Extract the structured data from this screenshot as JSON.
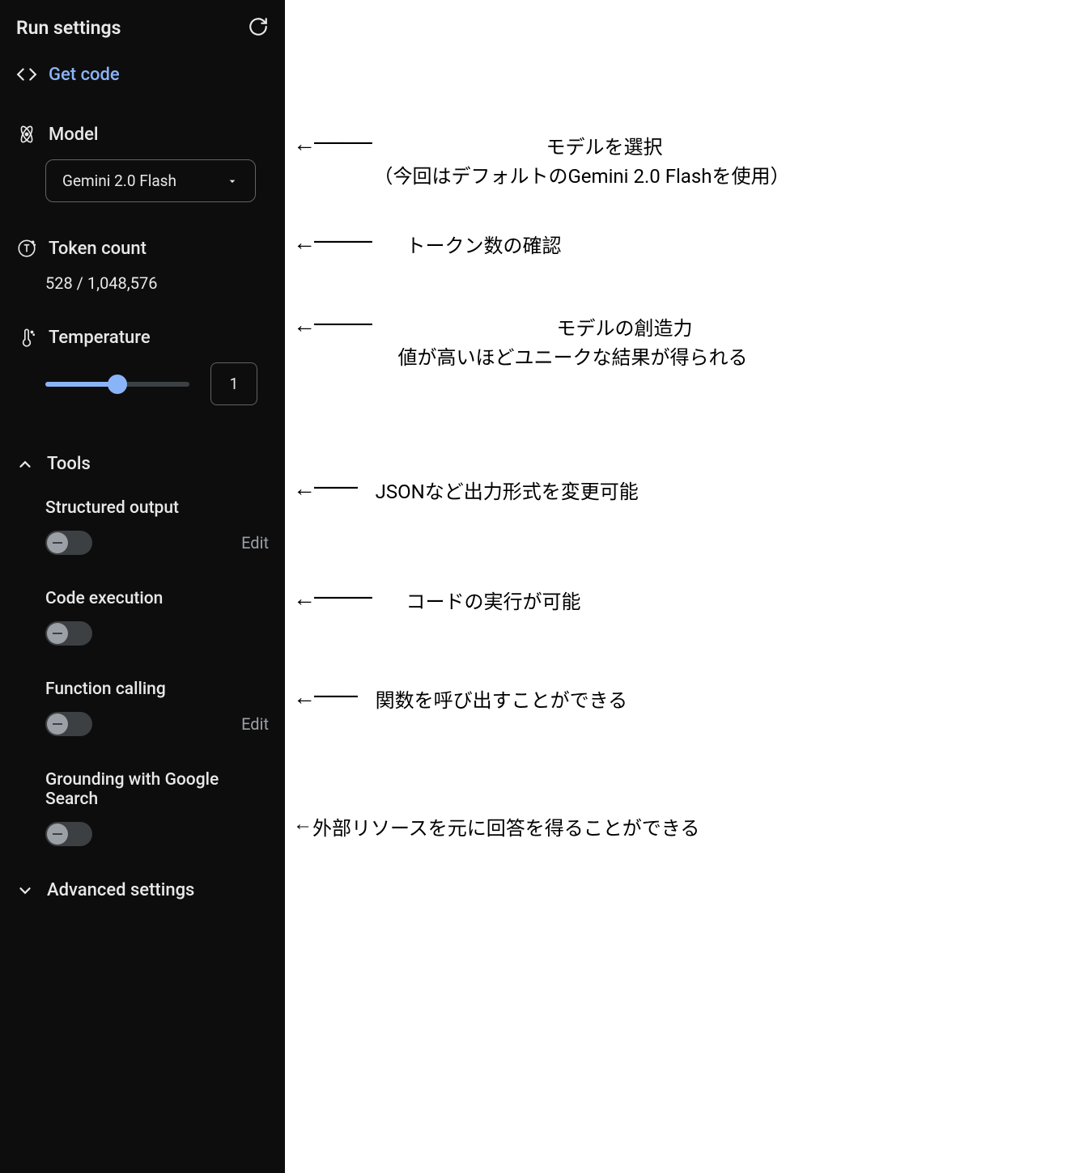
{
  "header": {
    "title": "Run settings"
  },
  "get_code": {
    "label": "Get code"
  },
  "model": {
    "label": "Model",
    "selected": "Gemini 2.0 Flash"
  },
  "token_count": {
    "label": "Token count",
    "value": "528 / 1,048,576"
  },
  "temperature": {
    "label": "Temperature",
    "value": "1"
  },
  "tools": {
    "label": "Tools",
    "structured_output": {
      "label": "Structured output",
      "edit": "Edit"
    },
    "code_execution": {
      "label": "Code execution"
    },
    "function_calling": {
      "label": "Function calling",
      "edit": "Edit"
    },
    "grounding": {
      "label": "Grounding with Google Search"
    }
  },
  "advanced": {
    "label": "Advanced settings"
  },
  "annotations": {
    "model_line1": "モデルを選択",
    "model_line2": "（今回はデフォルトのGemini 2.0 Flashを使用）",
    "token": "トークン数の確認",
    "temp_line1": "モデルの創造力",
    "temp_line2": "値が高いほどユニークな結果が得られる",
    "structured": "JSONなど出力形式を変更可能",
    "code_exec": "コードの実行が可能",
    "func_call": "関数を呼び出すことができる",
    "grounding": "外部リソースを元に回答を得ることができる"
  }
}
